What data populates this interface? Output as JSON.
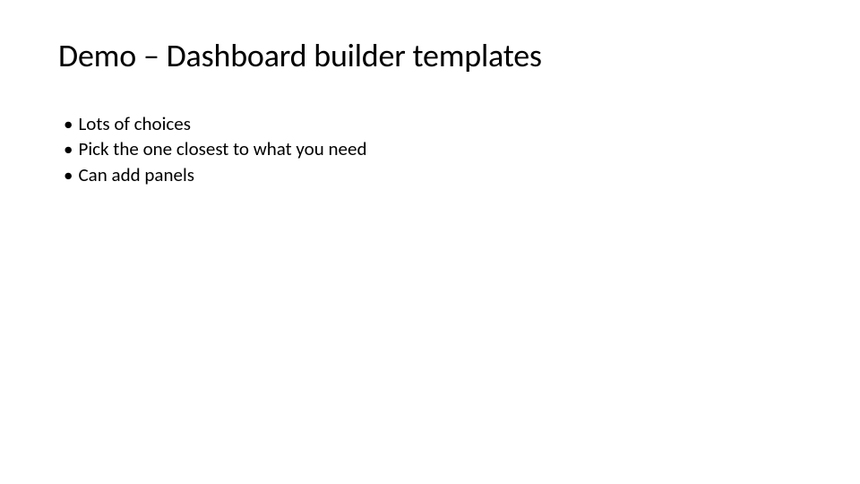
{
  "title": "Demo – Dashboard builder templates",
  "bullets": [
    "Lots of choices",
    "Pick the one closest to what you need",
    "Can add panels"
  ]
}
